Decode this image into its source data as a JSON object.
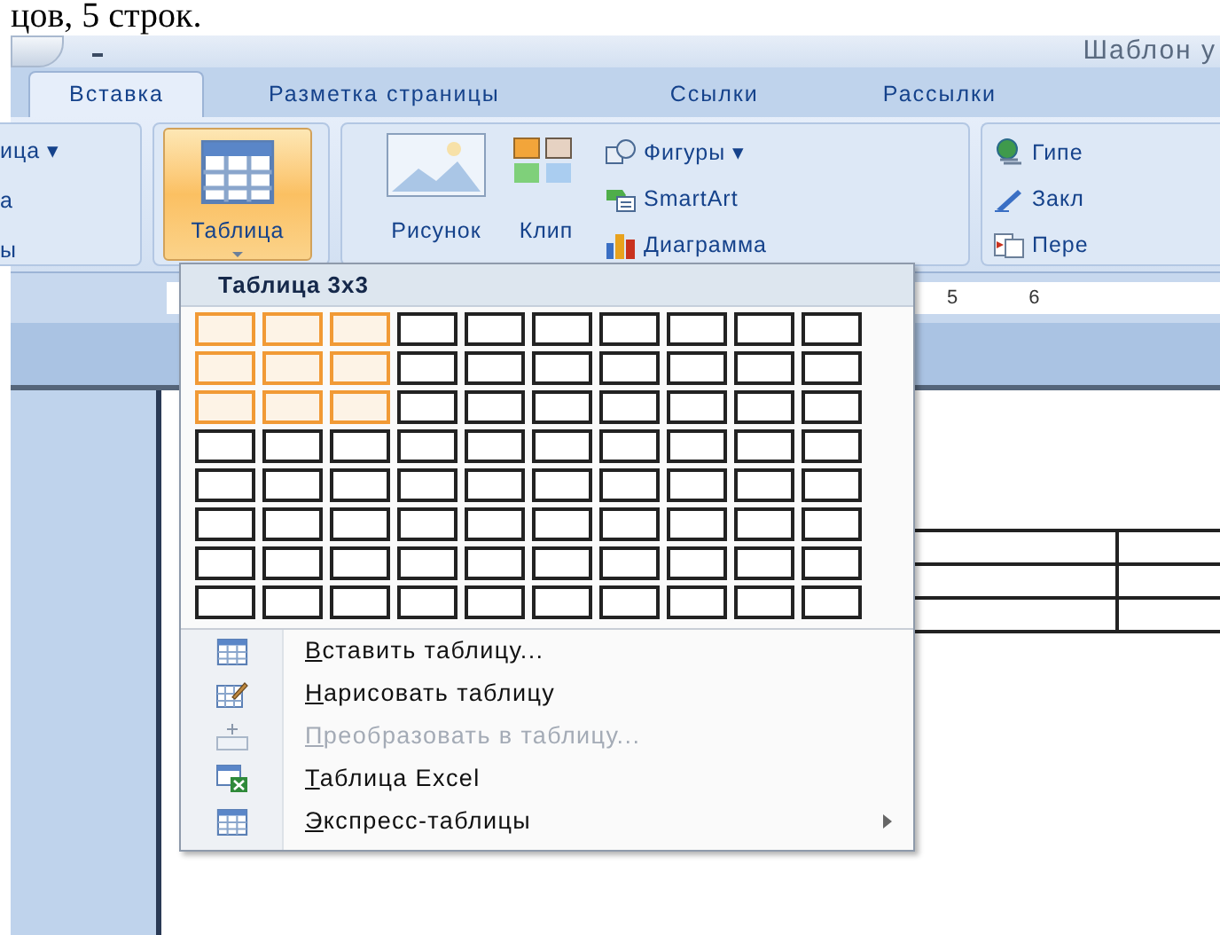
{
  "caption_fragment": "цов, 5 строк.",
  "window": {
    "title": "Шаблон у"
  },
  "tabs": [
    {
      "label": "Вставка",
      "selected": true
    },
    {
      "label": "Разметка страницы",
      "selected": false
    },
    {
      "label": "Ссылки",
      "selected": false
    },
    {
      "label": "Рассылки",
      "selected": false
    }
  ],
  "ribbon": {
    "left_group": [
      "ица ▾",
      "а",
      "ы"
    ],
    "table_button": {
      "label": "Таблица",
      "pressed": true
    },
    "picture_button": "Рисунок",
    "clip_button": "Клип",
    "small_buttons": [
      {
        "kind": "shapes",
        "label": "Фигуры ▾"
      },
      {
        "kind": "smartart",
        "label": "SmartArt"
      },
      {
        "kind": "chart",
        "label": "Диаграмма"
      }
    ],
    "links_group": [
      {
        "kind": "globe",
        "label": "Гипе"
      },
      {
        "kind": "bookmark",
        "label": "Закл"
      },
      {
        "kind": "crossref",
        "label": "Пере"
      }
    ]
  },
  "ruler": {
    "labels": [
      "5",
      "6"
    ]
  },
  "table_menu": {
    "header": "Таблица 3x3",
    "grid_rows": [
      [
        {
          "selected": true
        },
        {
          "selected": true
        },
        {
          "selected": true
        },
        {
          "selected": false
        },
        {
          "selected": false
        },
        {
          "selected": false
        },
        {
          "selected": false
        },
        {
          "selected": false
        },
        {
          "selected": false
        },
        {
          "selected": false
        }
      ],
      [
        {
          "selected": true
        },
        {
          "selected": true
        },
        {
          "selected": true
        },
        {
          "selected": false
        },
        {
          "selected": false
        },
        {
          "selected": false
        },
        {
          "selected": false
        },
        {
          "selected": false
        },
        {
          "selected": false
        },
        {
          "selected": false
        }
      ],
      [
        {
          "selected": true
        },
        {
          "selected": true
        },
        {
          "selected": true
        },
        {
          "selected": false
        },
        {
          "selected": false
        },
        {
          "selected": false
        },
        {
          "selected": false
        },
        {
          "selected": false
        },
        {
          "selected": false
        },
        {
          "selected": false
        }
      ],
      [
        {
          "selected": false
        },
        {
          "selected": false
        },
        {
          "selected": false
        },
        {
          "selected": false
        },
        {
          "selected": false
        },
        {
          "selected": false
        },
        {
          "selected": false
        },
        {
          "selected": false
        },
        {
          "selected": false
        },
        {
          "selected": false
        }
      ],
      [
        {
          "selected": false
        },
        {
          "selected": false
        },
        {
          "selected": false
        },
        {
          "selected": false
        },
        {
          "selected": false
        },
        {
          "selected": false
        },
        {
          "selected": false
        },
        {
          "selected": false
        },
        {
          "selected": false
        },
        {
          "selected": false
        }
      ],
      [
        {
          "selected": false
        },
        {
          "selected": false
        },
        {
          "selected": false
        },
        {
          "selected": false
        },
        {
          "selected": false
        },
        {
          "selected": false
        },
        {
          "selected": false
        },
        {
          "selected": false
        },
        {
          "selected": false
        },
        {
          "selected": false
        }
      ],
      [
        {
          "selected": false
        },
        {
          "selected": false
        },
        {
          "selected": false
        },
        {
          "selected": false
        },
        {
          "selected": false
        },
        {
          "selected": false
        },
        {
          "selected": false
        },
        {
          "selected": false
        },
        {
          "selected": false
        },
        {
          "selected": false
        }
      ],
      [
        {
          "selected": false
        },
        {
          "selected": false
        },
        {
          "selected": false
        },
        {
          "selected": false
        },
        {
          "selected": false
        },
        {
          "selected": false
        },
        {
          "selected": false
        },
        {
          "selected": false
        },
        {
          "selected": false
        },
        {
          "selected": false
        }
      ]
    ],
    "items": [
      {
        "kind": "insert",
        "label": "Вставить таблицу...",
        "disabled": false,
        "submenu": false
      },
      {
        "kind": "draw",
        "label": "Нарисовать таблицу",
        "disabled": false,
        "submenu": false
      },
      {
        "kind": "convert",
        "label": "Преобразовать в таблицу...",
        "disabled": true,
        "submenu": false
      },
      {
        "kind": "excel",
        "label": "Таблица Excel",
        "disabled": false,
        "submenu": false
      },
      {
        "kind": "quick",
        "label": "Экспресс-таблицы",
        "disabled": false,
        "submenu": true
      }
    ]
  }
}
